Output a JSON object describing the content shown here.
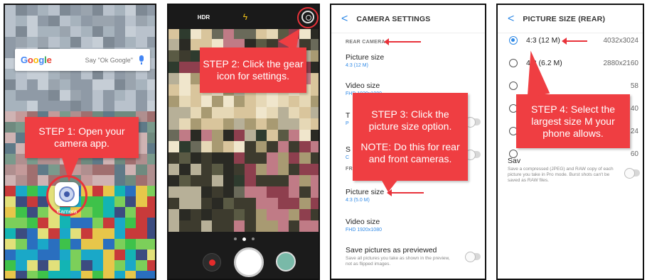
{
  "steps": {
    "step1": "STEP 1: Open your camera app.",
    "step2": "STEP 2: Click the gear icon for settings.",
    "step3_main": "STEP 3: Click the picture size option.",
    "step3_note": "NOTE: Do this for rear and front cameras.",
    "step4": "STEP 4: Select the largest size M your phone allows."
  },
  "panel1": {
    "google_logo": "Google",
    "google_hint": "Say \"Ok Google\"",
    "camera_app_label": "Camera",
    "icons": [
      "google-mic-icon",
      "camera-app-icon"
    ]
  },
  "panel2": {
    "top_icons": {
      "switch": "⟳",
      "hdr": "HDR",
      "flash": "ϟ"
    },
    "icons": [
      "switch-camera-icon",
      "hdr-icon",
      "flash-icon",
      "gear-icon",
      "record-icon",
      "shutter-icon",
      "gallery-thumbnail-icon"
    ]
  },
  "panel3": {
    "title": "CAMERA SETTINGS",
    "back_glyph": "<",
    "section_rear": "REAR CAMERA",
    "section_front": "FR",
    "items": [
      {
        "title": "Picture size",
        "value": "4:3 (12 M)"
      },
      {
        "title": "Video size",
        "value": "FHD 1920x1080"
      },
      {
        "title": "T",
        "value": "P"
      },
      {
        "title": "S",
        "value": "C"
      },
      {
        "title": "Picture size",
        "value": "4:3 (5.0 M)"
      },
      {
        "title": "Video size",
        "value": "FHD 1920x1080"
      },
      {
        "title": "Save pictures as previewed",
        "desc": "Save all pictures you take as shown in the preview, not as flipped images."
      }
    ]
  },
  "panel4": {
    "title": "PICTURE SIZE (REAR)",
    "back_glyph": "<",
    "options": [
      {
        "label": "4:3 (12 M)",
        "res": "4032x3024",
        "selected": true
      },
      {
        "label": "4:3 (6.2 M)",
        "res": "2880x2160",
        "selected": false
      },
      {
        "label": "",
        "res": "58",
        "selected": false
      },
      {
        "label": "",
        "res": "40",
        "selected": false
      },
      {
        "label": "",
        "res": "24",
        "selected": false
      },
      {
        "label": "",
        "res": "60",
        "selected": false
      }
    ],
    "save_title": "Sav",
    "save_desc": "Save a compressed (JPEG) and RAW copy of each picture you take in Pro mode. Burst shots can't be saved as RAW files."
  },
  "colors": {
    "callout": "#ef3e42",
    "accent_blue": "#2f89e6",
    "ring_red": "#e8323a"
  }
}
